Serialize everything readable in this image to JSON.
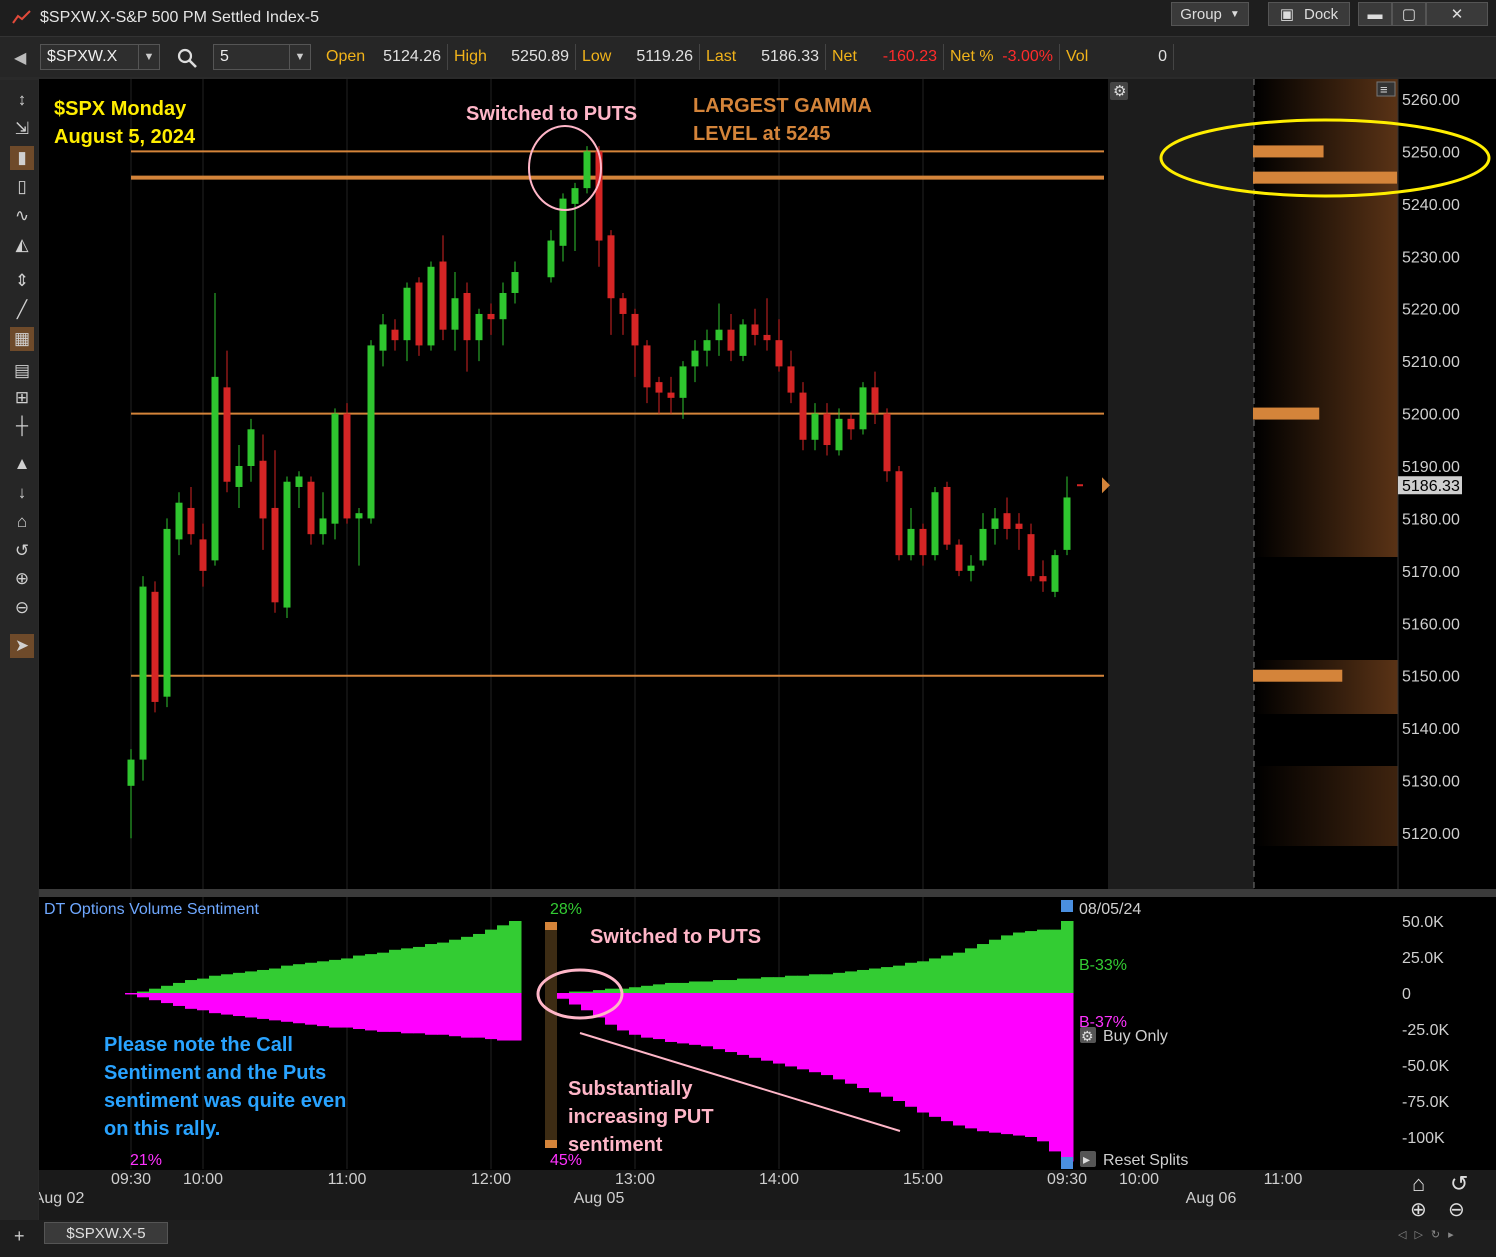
{
  "window": {
    "title": "$SPXW.X-S&P 500 PM Settled Index-5",
    "group_label": "Group",
    "dock_label": "Dock",
    "minimize_icon": "minimize-icon",
    "maximize_icon": "maximize-icon",
    "close_icon": "close-icon"
  },
  "toolbar": {
    "symbol": "$SPXW.X",
    "interval": "5",
    "quote": [
      {
        "label": "Open",
        "value": "5124.26",
        "neg": false
      },
      {
        "label": "High",
        "value": "5250.89",
        "neg": false
      },
      {
        "label": "Low",
        "value": "5119.26",
        "neg": false
      },
      {
        "label": "Last",
        "value": "5186.33",
        "neg": false
      },
      {
        "label": "Net",
        "value": "-160.23",
        "neg": true
      },
      {
        "label": "Net %",
        "value": "-3.00%",
        "neg": true
      },
      {
        "label": "Vol",
        "value": "0",
        "neg": false
      }
    ]
  },
  "tools": [
    "cursor-vertical-icon",
    "cursor-move-icon",
    "candles-icon",
    "bars-icon",
    "line-icon",
    "area-icon",
    "zoom-vertical-icon",
    "trendline-icon",
    "grid-icon",
    "table-icon",
    "grid-small-icon",
    "crosshair-icon",
    "pin-icon",
    "pin-small-icon",
    "home-icon",
    "undo-icon",
    "zoom-in-icon",
    "zoom-out-icon",
    "pointer-icon"
  ],
  "annotations": {
    "spx_line1": "$SPX Monday",
    "spx_line2": "August 5, 2024",
    "switched_top": "Switched to PUTS",
    "gamma_line1": "LARGEST GAMMA",
    "gamma_line2": "LEVEL at 5245",
    "switched_bottom": "Switched to PUTS",
    "note_lines": [
      "Please note the Call",
      "Sentiment and the Puts",
      "sentiment was quite even",
      "on this rally."
    ],
    "increase_lines": [
      "Substantially",
      "increasing PUT",
      "sentiment"
    ]
  },
  "price_axis": {
    "labels": [
      "5260.00",
      "5250.00",
      "5240.00",
      "5230.00",
      "5220.00",
      "5210.00",
      "5200.00",
      "5190.00",
      "5180.00",
      "5170.00",
      "5160.00",
      "5150.00",
      "5140.00",
      "5130.00",
      "5120.00"
    ],
    "last_tag": "5186.33"
  },
  "levels": [
    5250,
    5245,
    5200,
    5150
  ],
  "gamma_bars": [
    {
      "level": 5250,
      "size": 0.49
    },
    {
      "level": 5245,
      "size": 1.0
    },
    {
      "level": 5200,
      "size": 0.46
    },
    {
      "level": 5150,
      "size": 0.62
    }
  ],
  "sentiment": {
    "title": "DT Options Volume Sentiment",
    "pct_top": "28%",
    "pct_bottom_left": "21%",
    "pct_bottom_mid": "45%",
    "date": "08/05/24",
    "b_green": "B-33%",
    "b_magenta": "B-37%",
    "buy_only": "Buy Only",
    "reset_splits": "Reset Splits",
    "axis": [
      "50.0K",
      "25.0K",
      "0",
      "-25.0K",
      "-50.0K",
      "-75.0K",
      "-100K"
    ],
    "day1_calls": [
      0,
      1,
      3,
      5,
      7,
      9,
      10,
      12,
      13,
      14,
      15,
      16,
      17,
      19,
      20,
      21,
      22,
      23,
      24,
      26,
      27,
      28,
      30,
      31,
      32,
      34,
      35,
      37,
      39,
      41,
      44,
      47,
      50
    ],
    "day1_puts": [
      -1,
      -3,
      -5,
      -7,
      -9,
      -11,
      -12,
      -14,
      -15,
      -16,
      -17,
      -18,
      -19,
      -20,
      -21,
      -22,
      -23,
      -24,
      -24,
      -25,
      -26,
      -27,
      -27,
      -28,
      -28,
      -29,
      -29,
      -30,
      -31,
      -31,
      -32,
      -33,
      -33
    ],
    "day2_calls": [
      0,
      0,
      1,
      1,
      2,
      3,
      3,
      4,
      5,
      6,
      7,
      7,
      8,
      8,
      9,
      9,
      10,
      10,
      11,
      11,
      12,
      12,
      13,
      13,
      14,
      15,
      16,
      17,
      18,
      19,
      21,
      22,
      24,
      26,
      28,
      31,
      34,
      37,
      40,
      42,
      43,
      44,
      44,
      50
    ],
    "day2_puts": [
      -2,
      -4,
      -8,
      -12,
      -17,
      -22,
      -26,
      -29,
      -31,
      -32,
      -34,
      -35,
      -36,
      -37,
      -39,
      -41,
      -43,
      -45,
      -47,
      -49,
      -51,
      -53,
      -55,
      -57,
      -60,
      -63,
      -66,
      -69,
      -72,
      -75,
      -79,
      -83,
      -86,
      -89,
      -92,
      -94,
      -96,
      -97,
      -98,
      -99,
      -100,
      -103,
      -110,
      -117
    ]
  },
  "time_axis": {
    "times": [
      {
        "label": "09:30",
        "x": 0
      },
      {
        "label": "10:00",
        "x": 6
      },
      {
        "label": "11:00",
        "x": 18
      },
      {
        "label": "12:00",
        "x": 30
      },
      {
        "label": "13:00",
        "x": 42
      },
      {
        "label": "14:00",
        "x": 54
      },
      {
        "label": "15:00",
        "x": 66
      },
      {
        "label": "09:30",
        "x": 78
      },
      {
        "label": "10:00",
        "x": 84
      },
      {
        "label": "11:00",
        "x": 96
      }
    ],
    "dates": [
      {
        "label": "Aug 02",
        "x": -6
      },
      {
        "label": "Aug 05",
        "x": 39
      },
      {
        "label": "Aug 06",
        "x": 90
      }
    ]
  },
  "chart_data": {
    "type": "candlestick",
    "title": "$SPXW.X-S&P 500 PM Settled Index-5",
    "ylim": [
      5110,
      5265
    ],
    "last": 5186.33,
    "x_note": "bar index, 5-minute bars; day1 Aug 02 bars 0-32, day2 Aug 05 bars 35-77",
    "candles": [
      {
        "i": 0,
        "o": 5129,
        "h": 5136,
        "l": 5119,
        "c": 5134
      },
      {
        "i": 1,
        "o": 5134,
        "h": 5169,
        "l": 5130,
        "c": 5167
      },
      {
        "i": 2,
        "o": 5166,
        "h": 5168,
        "l": 5143,
        "c": 5145
      },
      {
        "i": 3,
        "o": 5146,
        "h": 5180,
        "l": 5144,
        "c": 5178
      },
      {
        "i": 4,
        "o": 5176,
        "h": 5185,
        "l": 5173,
        "c": 5183
      },
      {
        "i": 5,
        "o": 5182,
        "h": 5186,
        "l": 5175,
        "c": 5177
      },
      {
        "i": 6,
        "o": 5176,
        "h": 5179,
        "l": 5167,
        "c": 5170
      },
      {
        "i": 7,
        "o": 5172,
        "h": 5223,
        "l": 5171,
        "c": 5207
      },
      {
        "i": 8,
        "o": 5205,
        "h": 5212,
        "l": 5185,
        "c": 5187
      },
      {
        "i": 9,
        "o": 5186,
        "h": 5194,
        "l": 5182,
        "c": 5190
      },
      {
        "i": 10,
        "o": 5190,
        "h": 5199,
        "l": 5187,
        "c": 5197
      },
      {
        "i": 11,
        "o": 5191,
        "h": 5196,
        "l": 5174,
        "c": 5180
      },
      {
        "i": 12,
        "o": 5182,
        "h": 5193,
        "l": 5162,
        "c": 5164
      },
      {
        "i": 13,
        "o": 5163,
        "h": 5188,
        "l": 5161,
        "c": 5187
      },
      {
        "i": 14,
        "o": 5186,
        "h": 5189,
        "l": 5182,
        "c": 5188
      },
      {
        "i": 15,
        "o": 5187,
        "h": 5188,
        "l": 5175,
        "c": 5177
      },
      {
        "i": 16,
        "o": 5177,
        "h": 5185,
        "l": 5175,
        "c": 5180
      },
      {
        "i": 17,
        "o": 5179,
        "h": 5201,
        "l": 5176,
        "c": 5200
      },
      {
        "i": 18,
        "o": 5200,
        "h": 5202,
        "l": 5179,
        "c": 5180
      },
      {
        "i": 19,
        "o": 5180,
        "h": 5182,
        "l": 5171,
        "c": 5181
      },
      {
        "i": 20,
        "o": 5180,
        "h": 5214,
        "l": 5179,
        "c": 5213
      },
      {
        "i": 21,
        "o": 5212,
        "h": 5219,
        "l": 5209,
        "c": 5217
      },
      {
        "i": 22,
        "o": 5216,
        "h": 5218,
        "l": 5212,
        "c": 5214
      },
      {
        "i": 23,
        "o": 5214,
        "h": 5225,
        "l": 5210,
        "c": 5224
      },
      {
        "i": 24,
        "o": 5225,
        "h": 5226,
        "l": 5211,
        "c": 5213
      },
      {
        "i": 25,
        "o": 5213,
        "h": 5229,
        "l": 5212,
        "c": 5228
      },
      {
        "i": 26,
        "o": 5229,
        "h": 5234,
        "l": 5214,
        "c": 5216
      },
      {
        "i": 27,
        "o": 5216,
        "h": 5227,
        "l": 5212,
        "c": 5222
      },
      {
        "i": 28,
        "o": 5223,
        "h": 5225,
        "l": 5208,
        "c": 5214
      },
      {
        "i": 29,
        "o": 5214,
        "h": 5220,
        "l": 5210,
        "c": 5219
      },
      {
        "i": 30,
        "o": 5219,
        "h": 5221,
        "l": 5215,
        "c": 5218
      },
      {
        "i": 31,
        "o": 5218,
        "h": 5225,
        "l": 5213,
        "c": 5223
      },
      {
        "i": 32,
        "o": 5223,
        "h": 5229,
        "l": 5221,
        "c": 5227
      },
      {
        "i": 35,
        "o": 5226,
        "h": 5235,
        "l": 5225,
        "c": 5233
      },
      {
        "i": 36,
        "o": 5232,
        "h": 5242,
        "l": 5229,
        "c": 5241
      },
      {
        "i": 37,
        "o": 5240,
        "h": 5244,
        "l": 5231,
        "c": 5243
      },
      {
        "i": 38,
        "o": 5243,
        "h": 5251,
        "l": 5242,
        "c": 5250
      },
      {
        "i": 39,
        "o": 5250,
        "h": 5251,
        "l": 5228,
        "c": 5233
      },
      {
        "i": 40,
        "o": 5234,
        "h": 5235,
        "l": 5215,
        "c": 5222
      },
      {
        "i": 41,
        "o": 5222,
        "h": 5223,
        "l": 5215,
        "c": 5219
      },
      {
        "i": 42,
        "o": 5219,
        "h": 5220,
        "l": 5207,
        "c": 5213
      },
      {
        "i": 43,
        "o": 5213,
        "h": 5214,
        "l": 5202,
        "c": 5205
      },
      {
        "i": 44,
        "o": 5206,
        "h": 5207,
        "l": 5200,
        "c": 5204
      },
      {
        "i": 45,
        "o": 5204,
        "h": 5207,
        "l": 5200,
        "c": 5203
      },
      {
        "i": 46,
        "o": 5203,
        "h": 5210,
        "l": 5199,
        "c": 5209
      },
      {
        "i": 47,
        "o": 5209,
        "h": 5214,
        "l": 5206,
        "c": 5212
      },
      {
        "i": 48,
        "o": 5212,
        "h": 5216,
        "l": 5209,
        "c": 5214
      },
      {
        "i": 49,
        "o": 5214,
        "h": 5221,
        "l": 5211,
        "c": 5216
      },
      {
        "i": 50,
        "o": 5216,
        "h": 5219,
        "l": 5210,
        "c": 5212
      },
      {
        "i": 51,
        "o": 5211,
        "h": 5218,
        "l": 5210,
        "c": 5217
      },
      {
        "i": 52,
        "o": 5217,
        "h": 5220,
        "l": 5213,
        "c": 5215
      },
      {
        "i": 53,
        "o": 5215,
        "h": 5222,
        "l": 5212,
        "c": 5214
      },
      {
        "i": 54,
        "o": 5214,
        "h": 5218,
        "l": 5208,
        "c": 5209
      },
      {
        "i": 55,
        "o": 5209,
        "h": 5212,
        "l": 5202,
        "c": 5204
      },
      {
        "i": 56,
        "o": 5204,
        "h": 5206,
        "l": 5193,
        "c": 5195
      },
      {
        "i": 57,
        "o": 5195,
        "h": 5202,
        "l": 5193,
        "c": 5200
      },
      {
        "i": 58,
        "o": 5200,
        "h": 5202,
        "l": 5192,
        "c": 5194
      },
      {
        "i": 59,
        "o": 5193,
        "h": 5201,
        "l": 5192,
        "c": 5199
      },
      {
        "i": 60,
        "o": 5199,
        "h": 5200,
        "l": 5195,
        "c": 5197
      },
      {
        "i": 61,
        "o": 5197,
        "h": 5206,
        "l": 5196,
        "c": 5205
      },
      {
        "i": 62,
        "o": 5205,
        "h": 5208,
        "l": 5198,
        "c": 5200
      },
      {
        "i": 63,
        "o": 5200,
        "h": 5201,
        "l": 5187,
        "c": 5189
      },
      {
        "i": 64,
        "o": 5189,
        "h": 5190,
        "l": 5172,
        "c": 5173
      },
      {
        "i": 65,
        "o": 5173,
        "h": 5182,
        "l": 5172,
        "c": 5178
      },
      {
        "i": 66,
        "o": 5178,
        "h": 5179,
        "l": 5171,
        "c": 5173
      },
      {
        "i": 67,
        "o": 5173,
        "h": 5186,
        "l": 5172,
        "c": 5185
      },
      {
        "i": 68,
        "o": 5186,
        "h": 5187,
        "l": 5174,
        "c": 5175
      },
      {
        "i": 69,
        "o": 5175,
        "h": 5176,
        "l": 5169,
        "c": 5170
      },
      {
        "i": 70,
        "o": 5170,
        "h": 5173,
        "l": 5168,
        "c": 5171
      },
      {
        "i": 71,
        "o": 5172,
        "h": 5181,
        "l": 5171,
        "c": 5178
      },
      {
        "i": 72,
        "o": 5178,
        "h": 5182,
        "l": 5175,
        "c": 5180
      },
      {
        "i": 73,
        "o": 5181,
        "h": 5184,
        "l": 5176,
        "c": 5178
      },
      {
        "i": 74,
        "o": 5179,
        "h": 5181,
        "l": 5174,
        "c": 5178
      },
      {
        "i": 75,
        "o": 5177,
        "h": 5179,
        "l": 5168,
        "c": 5169
      },
      {
        "i": 76,
        "o": 5169,
        "h": 5172,
        "l": 5166,
        "c": 5168
      },
      {
        "i": 77,
        "o": 5166,
        "h": 5174,
        "l": 5165,
        "c": 5173
      },
      {
        "i": 78,
        "o": 5174,
        "h": 5188,
        "l": 5173,
        "c": 5184
      }
    ],
    "colors": {
      "up": "#2fc52f",
      "down": "#d52525",
      "level": "#d4843a",
      "calls": "#33cc33",
      "puts": "#ff00ff"
    }
  }
}
